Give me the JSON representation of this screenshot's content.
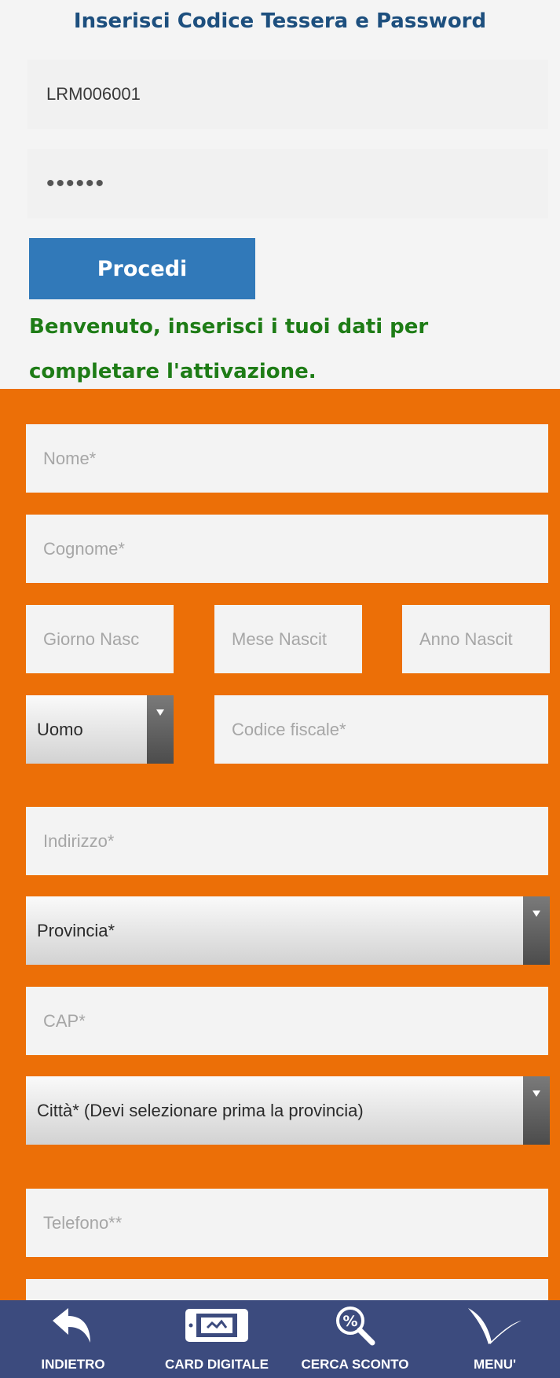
{
  "header": {
    "title": "Inserisci Codice Tessera e Password"
  },
  "login": {
    "card_code_value": "LRM006001",
    "password_value": "••••••",
    "submit_label": "Procedi"
  },
  "welcome_message": "Benvenuto, inserisci i tuoi dati per completare l'attivazione.",
  "form": {
    "first_name_placeholder": "Nome*",
    "last_name_placeholder": "Cognome*",
    "birth_day_placeholder": "Giorno Nasc",
    "birth_month_placeholder": "Mese Nascit",
    "birth_year_placeholder": "Anno Nascit",
    "gender_selected": "Uomo",
    "tax_code_placeholder": "Codice fiscale*",
    "address_placeholder": "Indirizzo*",
    "province_selected": "Provincia*",
    "zip_placeholder": "CAP*",
    "city_selected": "Città* (Devi selezionare prima la provincia)",
    "phone_placeholder": "Telefono**"
  },
  "bottom_nav": {
    "items": [
      {
        "label": "INDIETRO",
        "icon": "back-arrow-icon"
      },
      {
        "label": "CARD DIGITALE",
        "icon": "tablet-card-icon"
      },
      {
        "label": "CERCA SCONTO",
        "icon": "percent-search-icon"
      },
      {
        "label": "MENU'",
        "icon": "menu-leaf-icon"
      }
    ]
  },
  "colors": {
    "title": "#1d4f7e",
    "button": "#3179b9",
    "welcome": "#1e7c16",
    "form_background": "#ec6f07",
    "navbar": "#3c4b7e"
  }
}
